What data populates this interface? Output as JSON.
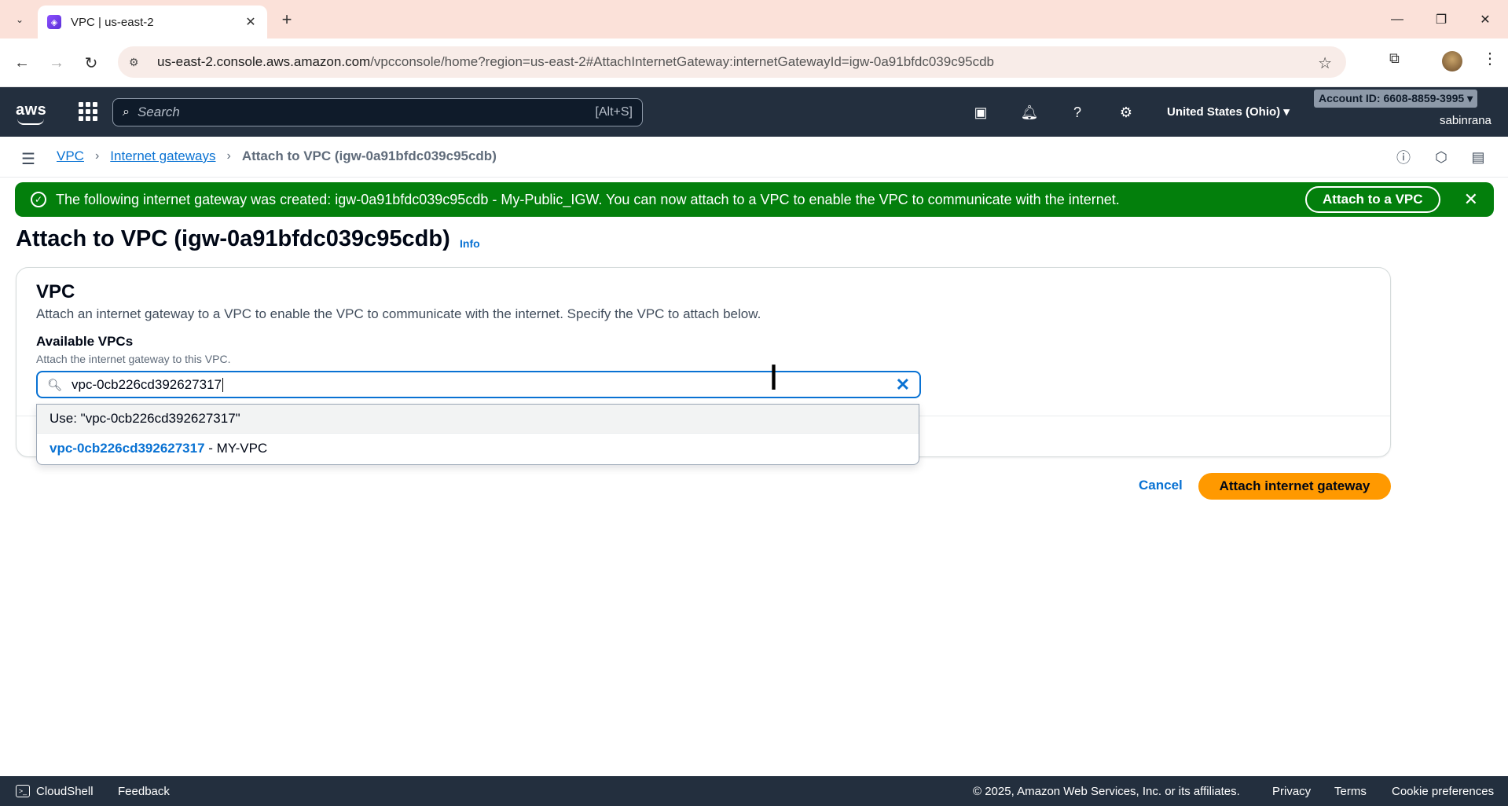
{
  "browser": {
    "tab_title": "VPC | us-east-2",
    "url_host": "us-east-2.console.aws.amazon.com",
    "url_path": "/vpcconsole/home?region=us-east-2#AttachInternetGateway:internetGatewayId=igw-0a91bfdc039c95cdb"
  },
  "aws_nav": {
    "logo": "aws",
    "search_placeholder": "Search",
    "search_shortcut": "[Alt+S]",
    "region": "United States (Ohio) ▾",
    "account": "Account ID: 6608-8859-3995 ▾",
    "username": "sabinrana"
  },
  "breadcrumb": {
    "items": [
      "VPC",
      "Internet gateways"
    ],
    "current": "Attach to VPC (igw-0a91bfdc039c95cdb)"
  },
  "flash": {
    "message": "The following internet gateway was created: igw-0a91bfdc039c95cdb - My-Public_IGW. You can now attach to a VPC to enable the VPC to communicate with the internet.",
    "action_label": "Attach to a VPC",
    "color": "#037f0c"
  },
  "page": {
    "title": "Attach to VPC (igw-0a91bfdc039c95cdb)",
    "info_label": "Info"
  },
  "vpc_section": {
    "title": "VPC",
    "description": "Attach an internet gateway to a VPC to enable the VPC to communicate with the internet. Specify the VPC to attach below.",
    "field_label": "Available VPCs",
    "field_description": "Attach the internet gateway to this VPC.",
    "input_value": "vpc-0cb226cd392627317",
    "suggestions": {
      "use_entered": "Use: \"vpc-0cb226cd392627317\"",
      "option_id": "vpc-0cb226cd392627317",
      "option_name": " - MY-VPC"
    }
  },
  "actions": {
    "cancel": "Cancel",
    "submit": "Attach internet gateway",
    "accent": "#ff9900"
  },
  "footer": {
    "cloudshell": "CloudShell",
    "feedback": "Feedback",
    "copyright": "© 2025, Amazon Web Services, Inc. or its affiliates.",
    "privacy": "Privacy",
    "terms": "Terms",
    "cookies": "Cookie preferences"
  },
  "icons": [
    "chevron-down-icon",
    "close-icon",
    "plus-icon",
    "back-icon",
    "forward-icon",
    "reload-icon",
    "site-info-icon",
    "star-icon",
    "extensions-icon",
    "menu-icon",
    "apps-grid-icon",
    "search-icon",
    "cloudshell-icon",
    "bell-icon",
    "help-icon",
    "settings-icon",
    "hamburger-icon",
    "info-icon",
    "check-circle-icon"
  ]
}
